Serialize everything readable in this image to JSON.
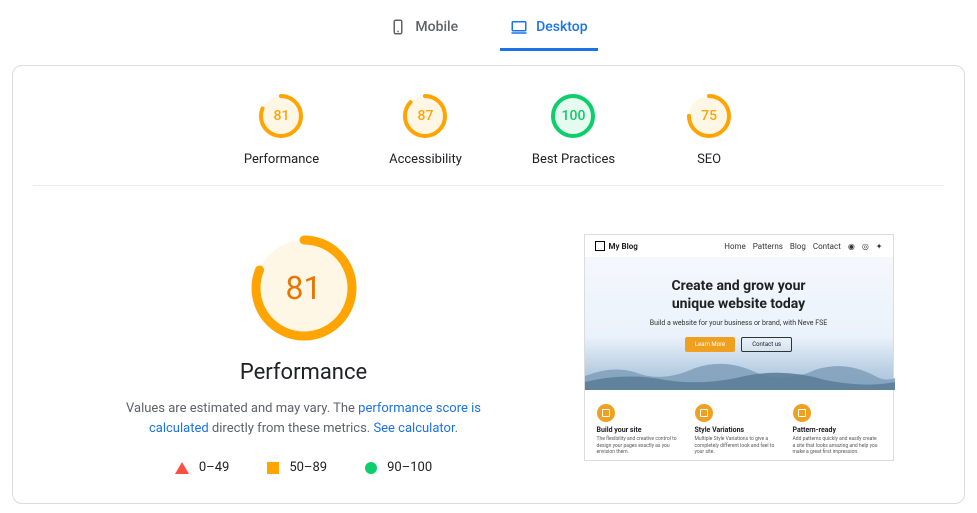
{
  "tabs": {
    "mobile": "Mobile",
    "desktop": "Desktop"
  },
  "gauges": [
    {
      "score": 81,
      "label": "Performance",
      "color": "#ffa400",
      "bg": "#fff7e6"
    },
    {
      "score": 87,
      "label": "Accessibility",
      "color": "#ffa400",
      "bg": "#fff7e6"
    },
    {
      "score": 100,
      "label": "Best Practices",
      "color": "#0cce6b",
      "bg": "#e6faef"
    },
    {
      "score": 75,
      "label": "SEO",
      "color": "#ffa400",
      "bg": "#fff7e6"
    }
  ],
  "performance": {
    "score": 81,
    "title": "Performance",
    "desc_1": "Values are estimated and may vary. The ",
    "link_1": "performance score is calculated",
    "desc_2": " directly from these metrics. ",
    "link_2": "See calculator",
    "desc_3": "."
  },
  "legend": {
    "r1": "0–49",
    "r2": "50–89",
    "r3": "90–100"
  },
  "preview": {
    "site": "My Blog",
    "nav": [
      "Home",
      "Patterns",
      "Blog",
      "Contact"
    ],
    "hero_1": "Create and grow your",
    "hero_2": "unique website today",
    "sub": "Build a website for your business or brand, with Neve FSE",
    "btn1": "Learn More",
    "btn2": "Contact us",
    "features": [
      {
        "t": "Build your site",
        "d": "The flexibility and creative control to design your pages exactly as you envision them."
      },
      {
        "t": "Style Variations",
        "d": "Multiple Style Variations to give a completely different look and feel to your site."
      },
      {
        "t": "Pattern-ready",
        "d": "Add patterns quickly and easily create a site that looks amazing and help you make a great first impression."
      }
    ]
  }
}
